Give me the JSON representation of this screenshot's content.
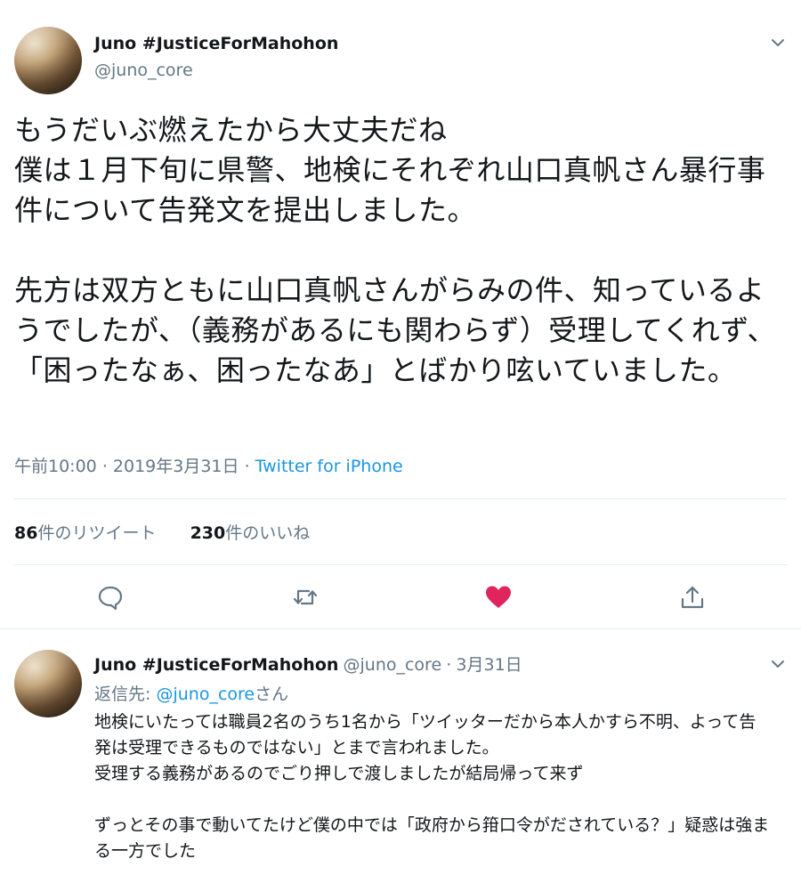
{
  "tweet": {
    "author_name": "Juno #JusticeForMahohon",
    "author_handle": "@juno_core",
    "text": "もうだいぶ燃えたから大丈夫だね\n僕は１月下旬に県警、地検にそれぞれ山口真帆さん暴行事件について告発文を提出しました。\n\n先方は双方ともに山口真帆さんがらみの件、知っているようでしたが、（義務があるにも関わらず）受理してくれず、「困ったなぁ、困ったなあ」とばかり呟いていました。",
    "time": "午前10:00",
    "date": "2019年3月31日",
    "separator": "·",
    "source": "Twitter for iPhone",
    "retweet_count": "86",
    "retweet_label": "件のリツイート",
    "like_count": "230",
    "like_label": "件のいいね",
    "liked": true
  },
  "reply": {
    "author_name": "Juno #JusticeForMahohon",
    "author_handle": "@juno_core",
    "separator": "·",
    "date": "3月31日",
    "replying_prefix": "返信先: ",
    "replying_to": "@juno_core",
    "replying_suffix": "さん",
    "text": "地検にいたっては職員2名のうち1名から「ツイッターだから本人かすら不明、よって告発は受理できるものではない」とまで言われました。\n受理する義務があるのでごり押しで渡しましたが結局帰って来ず\n\nずっとその事で動いてたけど僕の中では「政府から箝口令がだされている？」疑惑は強まる一方でした"
  },
  "icons": {
    "reply": "reply-icon",
    "retweet": "retweet-icon",
    "like": "heart-icon",
    "share": "share-icon",
    "menu": "chevron-down-icon"
  },
  "colors": {
    "link": "#1b95e0",
    "muted": "#657786",
    "like": "#e0245e",
    "divider": "#e6ecf0"
  }
}
